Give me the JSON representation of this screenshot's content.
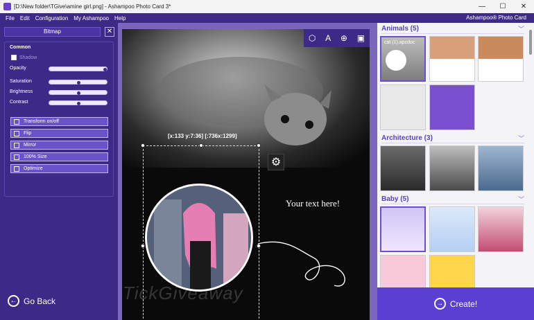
{
  "window": {
    "title": "[D:\\New folder\\TGive\\amine girl.png] - Ashampoo Photo Card 3*",
    "minimize": "—",
    "maximize": "☐",
    "close": "✕"
  },
  "menubar": {
    "items": [
      "File",
      "Edit",
      "Configuration",
      "My Ashampoo",
      "Help"
    ],
    "brand": "Ashampoo® Photo Card"
  },
  "leftpanel": {
    "header": "Bitmap",
    "close": "✕",
    "section": "Common",
    "shadow_label": "Shadow",
    "sliders": [
      {
        "label": "Opacity",
        "value": 1.0
      },
      {
        "label": "Saturation",
        "value": 0.5
      },
      {
        "label": "Brightness",
        "value": 0.5
      },
      {
        "label": "Contrast",
        "value": 0.5
      }
    ],
    "actions": [
      "Transform on/off",
      "Flip",
      "Mirror",
      "100% Size",
      "Optimize"
    ],
    "go_back": "Go Back"
  },
  "canvas": {
    "coordinate_label": "[x:133 y:7:36] [:736x:1299]",
    "caption": "Your text here!",
    "watermark": "TickGiveaway",
    "tools": [
      "shapes-icon",
      "text-size-icon",
      "stamp-icon",
      "image-edit-icon"
    ]
  },
  "rightpanel": {
    "categories": [
      {
        "name": "Animals (5)",
        "thumb_count": 5
      },
      {
        "name": "Architecture (3)",
        "thumb_count": 3
      },
      {
        "name": "Baby (5)",
        "thumb_count": 5
      }
    ],
    "selected_thumb_text": "cat (1).apcdoc",
    "create": "Create!"
  }
}
